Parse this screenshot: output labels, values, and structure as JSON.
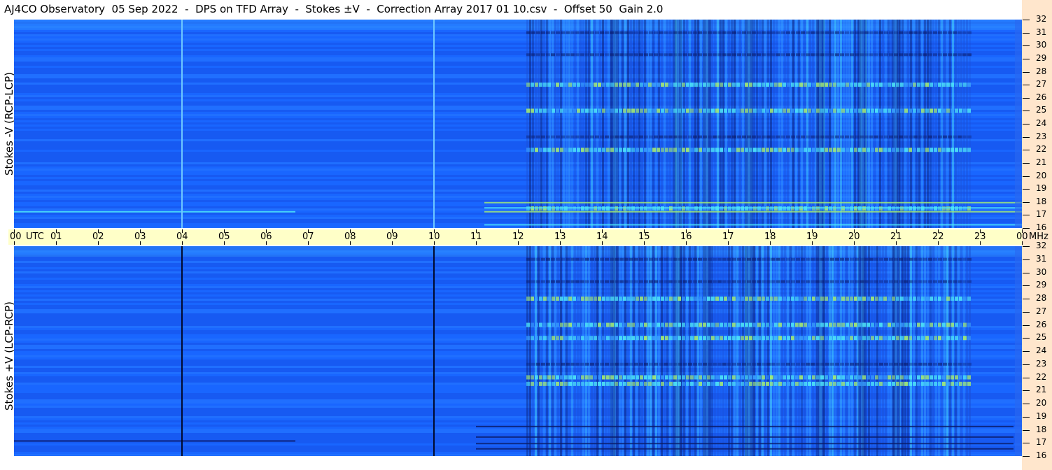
{
  "title": "AJ4CO Observatory  05 Sep 2022  -  DPS on TFD Array  -  Stokes ±V  -  Correction Array 2017 01 10.csv  -  Offset 50  Gain 2.0",
  "x_axis": {
    "tick_labels": [
      "00",
      "UTC",
      "01",
      "02",
      "03",
      "04",
      "05",
      "06",
      "07",
      "08",
      "09",
      "10",
      "11",
      "12",
      "13",
      "14",
      "15",
      "16",
      "17",
      "18",
      "19",
      "20",
      "21",
      "22",
      "23",
      "00",
      "MHz"
    ]
  },
  "colors": {
    "background_blue": "#1560ff",
    "light_blue": "#3aa2ff",
    "bright_cyan": "#4fe8f8",
    "green_yellow": "#a8f070",
    "dark_navy": "#0a1a66",
    "time_bar": "#ffffc8",
    "freq_strip": "#ffe6cc"
  },
  "chart_data": [
    {
      "type": "heatmap",
      "ylabel": "Stokes -V (RCP-LCP)",
      "x": {
        "label": "UTC",
        "range": [
          0,
          24
        ],
        "ticks": [
          "00",
          "01",
          "02",
          "03",
          "04",
          "05",
          "06",
          "07",
          "08",
          "09",
          "10",
          "11",
          "12",
          "13",
          "14",
          "15",
          "16",
          "17",
          "18",
          "19",
          "20",
          "21",
          "22",
          "23",
          "00"
        ]
      },
      "y": {
        "label": "MHz",
        "range": [
          16,
          32
        ],
        "ticks": [
          16,
          17,
          18,
          19,
          20,
          21,
          22,
          23,
          24,
          25,
          26,
          27,
          28,
          29,
          30,
          31,
          32
        ]
      },
      "vertical_lines_utc": [
        4.0,
        10.0
      ],
      "vertical_line_color": "#6ec8ff",
      "activity_window_utc": [
        12.2,
        22.8
      ],
      "bright_bands_mhz": [
        25,
        27,
        22,
        17.5
      ],
      "strong_columns_utc": [
        14.3,
        15.8,
        16.5,
        17.5,
        19.2,
        20.2,
        21.0
      ]
    },
    {
      "type": "heatmap",
      "ylabel": "Stokes +V (LCP-RCP)",
      "x": {
        "label": "UTC",
        "range": [
          0,
          24
        ],
        "ticks": [
          "00",
          "01",
          "02",
          "03",
          "04",
          "05",
          "06",
          "07",
          "08",
          "09",
          "10",
          "11",
          "12",
          "13",
          "14",
          "15",
          "16",
          "17",
          "18",
          "19",
          "20",
          "21",
          "22",
          "23",
          "00"
        ]
      },
      "y": {
        "label": "MHz",
        "range": [
          16,
          32
        ],
        "ticks": [
          16,
          17,
          18,
          19,
          20,
          21,
          22,
          23,
          24,
          25,
          26,
          27,
          28,
          29,
          30,
          31,
          32
        ]
      },
      "vertical_lines_utc": [
        4.0,
        10.0
      ],
      "vertical_line_color": "#000a2e",
      "activity_window_utc": [
        12.2,
        22.8
      ],
      "bright_bands_mhz": [
        28,
        26,
        25,
        22,
        21.5
      ],
      "strong_columns_utc": [
        14.3,
        15.8,
        16.5,
        17.5,
        19.2,
        20.2,
        21.0
      ]
    }
  ]
}
